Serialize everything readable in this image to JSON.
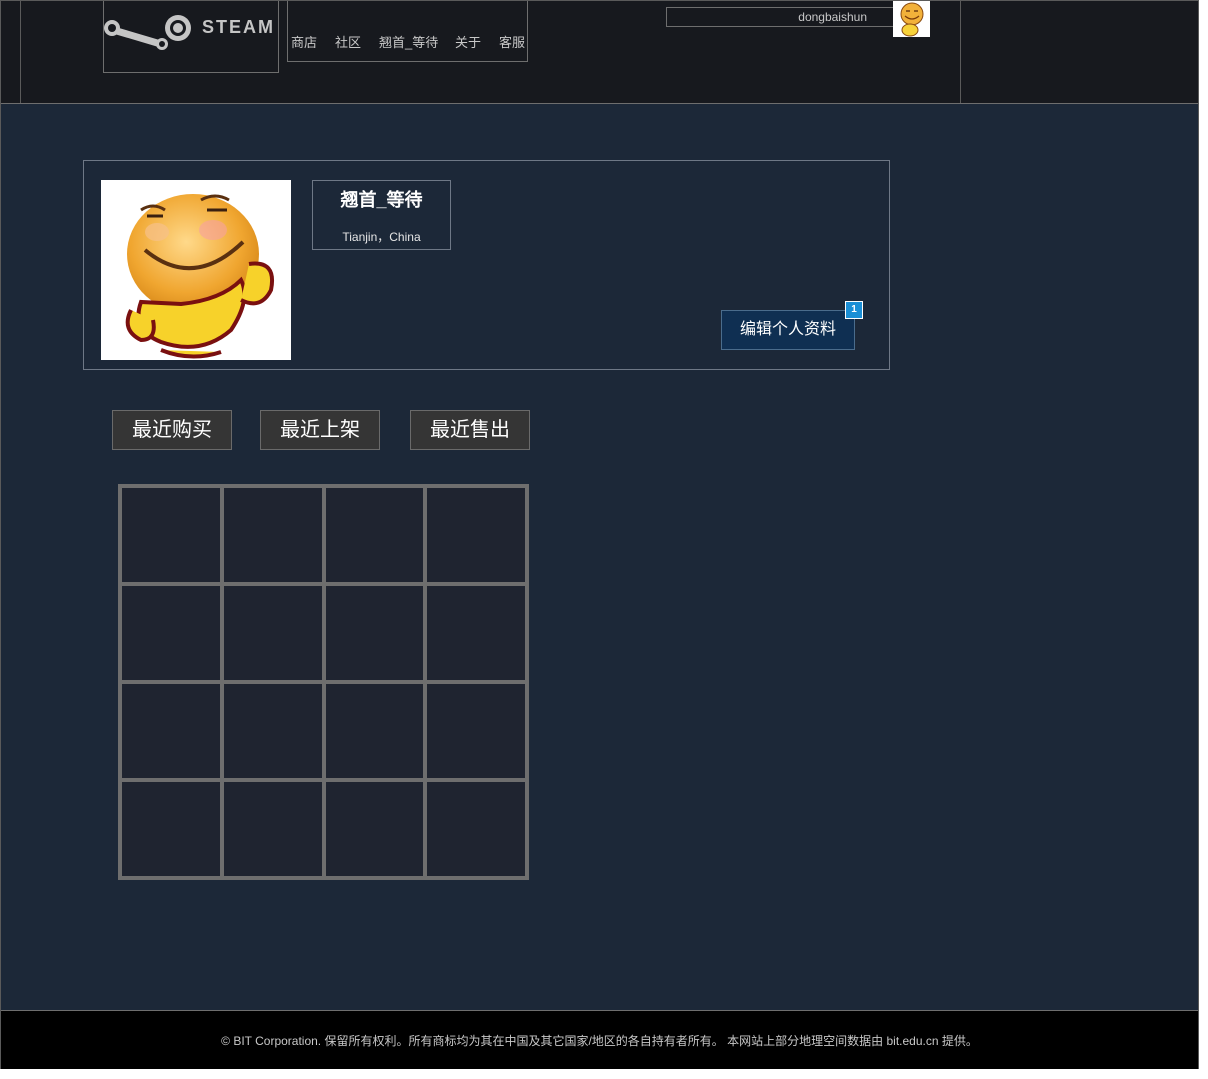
{
  "header": {
    "logo_text": "STEAM",
    "nav": [
      {
        "label": "商店"
      },
      {
        "label": "社区"
      },
      {
        "label": "翘首_等待"
      },
      {
        "label": "关于"
      },
      {
        "label": "客服"
      }
    ],
    "username": "dongbaishun"
  },
  "profile": {
    "name": "翘首_等待",
    "location": "Tianjin，China",
    "edit_label": "编辑个人资料",
    "badge_count": "1"
  },
  "tabs": [
    {
      "label": "最近购买"
    },
    {
      "label": "最近上架"
    },
    {
      "label": "最近售出"
    }
  ],
  "grid": {
    "rows": 4,
    "cols": 4
  },
  "footer": {
    "text": "© BIT Corporation. 保留所有权利。所有商标均为其在中国及其它国家/地区的各自持有者所有。 本网站上部分地理空间数据由 bit.edu.cn 提供。"
  },
  "colors": {
    "header_bg": "#17191e",
    "main_bg": "#1c2838",
    "edit_button_bg": "#0f2f52",
    "badge_bg": "#1a8fd6",
    "tab_bg": "#353535",
    "grid_border": "#6e6e6e",
    "cell_bg": "#1f2430"
  }
}
